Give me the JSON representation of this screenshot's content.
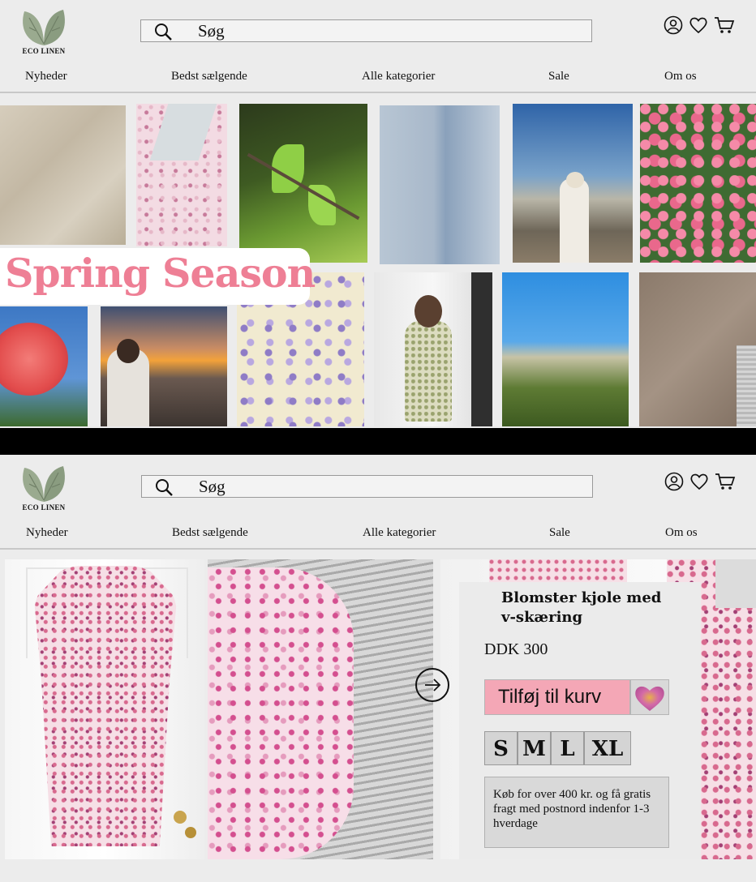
{
  "brand": {
    "logo_text": "ECO LINEN"
  },
  "search": {
    "placeholder": "Søg"
  },
  "nav": [
    "Nyheder",
    "Bedst sælgende",
    "Alle kategorier",
    "Sale",
    "Om os"
  ],
  "banner": {
    "headline": "Spring Season"
  },
  "product": {
    "title": "Blomster kjole med v-skæring",
    "price": "DDK 300",
    "add_to_cart": "Tilføj til kurv",
    "sizes": [
      "S",
      "M",
      "L",
      "XL"
    ],
    "shipping_info": "Køb for over 400 kr. og få gratis fragt med postnord indenfor 1-3 hverdage"
  },
  "colors": {
    "accent_pink": "#f4a7b6",
    "headline_pink": "#ee7f95",
    "background": "#ececec"
  },
  "icons": [
    "search-icon",
    "account-icon",
    "heart-icon",
    "cart-icon",
    "arrow-right-icon"
  ]
}
